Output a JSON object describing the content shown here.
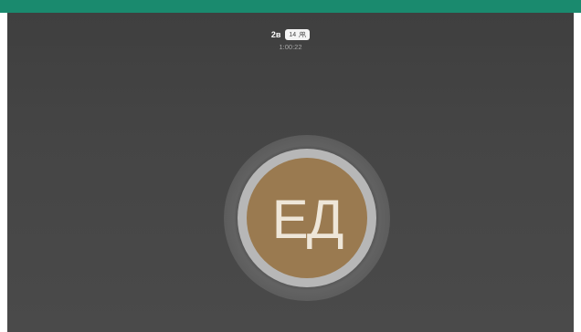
{
  "call": {
    "name": "2в",
    "participants_count": "14",
    "timer": "1:00:22"
  },
  "avatar": {
    "initials": "ЕД"
  },
  "colors": {
    "top_bar": "#1a8a6e",
    "stage_background": "#454545",
    "avatar_fill": "#9a7a50",
    "avatar_ring": "#b7b7b7"
  },
  "icons": {
    "participants": "people-icon"
  }
}
